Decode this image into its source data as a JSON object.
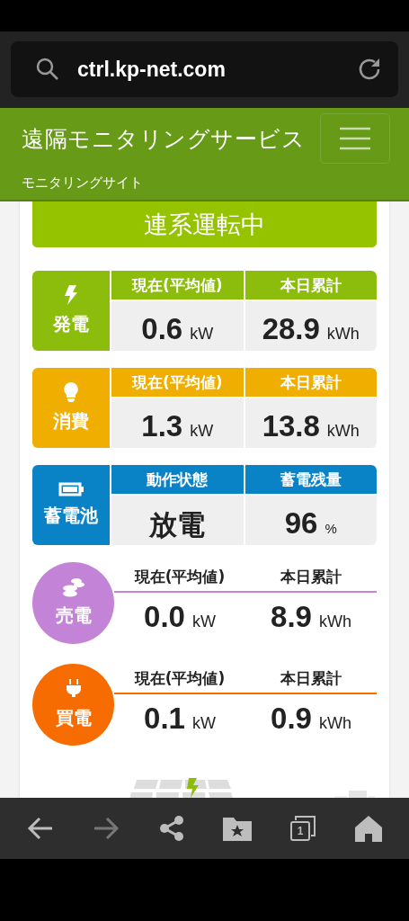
{
  "browser": {
    "url": "ctrl.kp-net.com"
  },
  "header": {
    "title": "遠隔モニタリングサービス",
    "subtitle": "モニタリングサイト"
  },
  "status_banner": "連系運転中",
  "panels": [
    {
      "kind": "table",
      "color": "#8dbd0c",
      "label": "発電",
      "columns": [
        {
          "heading": "現在(平均値)",
          "value": "0.6",
          "unit": "kW"
        },
        {
          "heading": "本日累計",
          "value": "28.9",
          "unit": "kWh"
        }
      ]
    },
    {
      "kind": "table",
      "color": "#f0ae00",
      "label": "消費",
      "columns": [
        {
          "heading": "現在(平均値)",
          "value": "1.3",
          "unit": "kW"
        },
        {
          "heading": "本日累計",
          "value": "13.8",
          "unit": "kWh"
        }
      ]
    },
    {
      "kind": "table",
      "color": "#0a83c6",
      "label": "蓄電池",
      "columns": [
        {
          "heading": "動作状態",
          "value": "放電"
        },
        {
          "heading": "蓄電残量",
          "value": "96",
          "unit": "%"
        }
      ]
    },
    {
      "kind": "circle",
      "color": "#c383d6",
      "label": "売電",
      "columns": [
        {
          "heading": "現在(平均値)",
          "value": "0.0",
          "unit": "kW"
        },
        {
          "heading": "本日累計",
          "value": "8.9",
          "unit": "kWh"
        }
      ]
    },
    {
      "kind": "circle",
      "color": "#f76c00",
      "label": "買電",
      "columns": [
        {
          "heading": "現在(平均値)",
          "value": "0.1",
          "unit": "kW"
        },
        {
          "heading": "本日累計",
          "value": "0.9",
          "unit": "kWh"
        }
      ]
    }
  ],
  "toolbar": [
    {
      "kind": "back",
      "disabled": false
    },
    {
      "kind": "forward",
      "disabled": true
    },
    {
      "kind": "share",
      "disabled": false
    },
    {
      "kind": "bookmarks",
      "disabled": false
    },
    {
      "kind": "tabs",
      "count": "1",
      "disabled": false
    },
    {
      "kind": "home",
      "disabled": false
    }
  ]
}
